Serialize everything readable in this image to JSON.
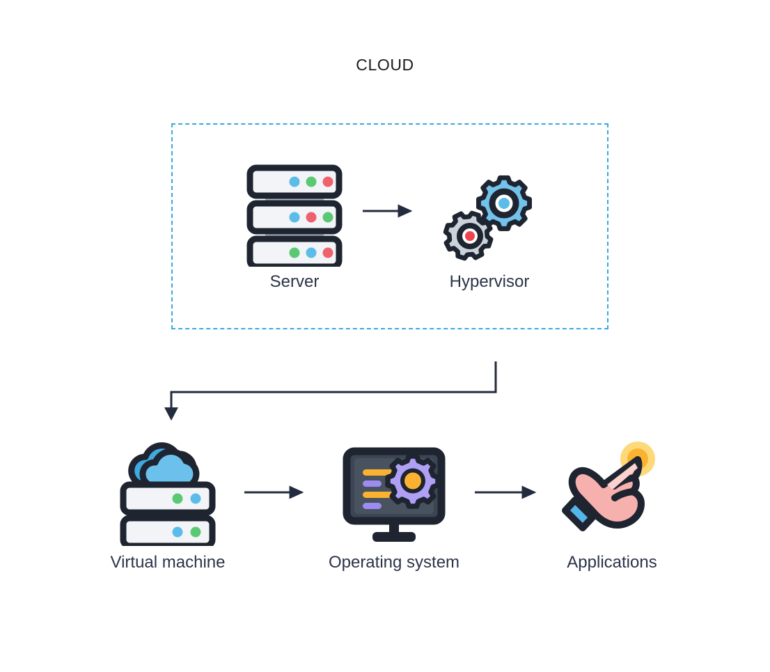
{
  "diagram": {
    "title": "CLOUD",
    "boundary": {
      "style": "dashed",
      "color": "#36A9E1",
      "label": "CLOUD"
    },
    "nodes": [
      {
        "id": "server",
        "label": "Server",
        "icon": "server-rack-icon",
        "group": "cloud",
        "colors": {
          "outline": "#1E2430",
          "panel": "#F2F4F7",
          "spacer": "#A8B6C3",
          "dot_blue": "#5BBCEA",
          "dot_green": "#5BC973",
          "dot_red": "#F0616E"
        },
        "dot_rows": [
          [
            "blue",
            "green",
            "red"
          ],
          [
            "blue",
            "red",
            "green"
          ],
          [
            "green",
            "blue",
            "red"
          ]
        ]
      },
      {
        "id": "hypervisor",
        "label": "Hypervisor",
        "icon": "gears-icon",
        "group": "cloud",
        "colors": {
          "outline": "#1E2430",
          "gear_blue": "#72C2EB",
          "gear_gray": "#CBD2D9",
          "hub_blue": "#5BBCEA",
          "hub_red": "#F0414E",
          "hub_white": "#FFFFFF"
        }
      },
      {
        "id": "virtual-machine",
        "label": "Virtual machine",
        "icon": "cloud-server-icon",
        "group": "stack",
        "colors": {
          "outline": "#1E2430",
          "panel": "#F2F4F7",
          "cloud_back": "#3FA9E0",
          "cloud_front": "#6CC0EC",
          "spacer": "#55B5E8",
          "dot_blue": "#5BBCEA",
          "dot_green": "#5BC973"
        },
        "dot_rows": [
          [
            "green",
            "blue"
          ],
          [
            "blue",
            "green"
          ]
        ]
      },
      {
        "id": "operating-system",
        "label": "Operating system",
        "icon": "monitor-gear-icon",
        "group": "stack",
        "colors": {
          "outline": "#1E2430",
          "screen": "#3C4553",
          "screen_light": "#49525F",
          "bar_orange": "#FBB231",
          "bar_purple": "#9C8CF0",
          "gear_purple": "#AFA0F5",
          "gear_hub": "#FBB231"
        },
        "screen_bars": [
          "orange",
          "purple",
          "orange",
          "purple"
        ]
      },
      {
        "id": "applications",
        "label": "Applications",
        "icon": "tap-hand-icon",
        "group": "stack",
        "colors": {
          "outline": "#1E2430",
          "hand": "#F6B0AE",
          "hand_light": "#FBD2CE",
          "cuff": "#55B5E8",
          "ripple_outer": "#FDD97A",
          "ripple_inner": "#FBB231"
        }
      }
    ],
    "arrows": [
      {
        "id": "server-to-hypervisor",
        "from": "server",
        "to": "hypervisor",
        "direction": "right"
      },
      {
        "id": "hypervisor-to-virtual-machine",
        "from": "hypervisor",
        "to": "virtual-machine",
        "direction": "down-left-elbow"
      },
      {
        "id": "virtual-machine-to-operating-system",
        "from": "virtual-machine",
        "to": "operating-system",
        "direction": "right"
      },
      {
        "id": "operating-system-to-applications",
        "from": "operating-system",
        "to": "applications",
        "direction": "right"
      }
    ],
    "colors": {
      "background": "#FFFFFF",
      "arrow": "#232B3E",
      "text": "#2B3348",
      "accent": "#36A9E1"
    }
  }
}
